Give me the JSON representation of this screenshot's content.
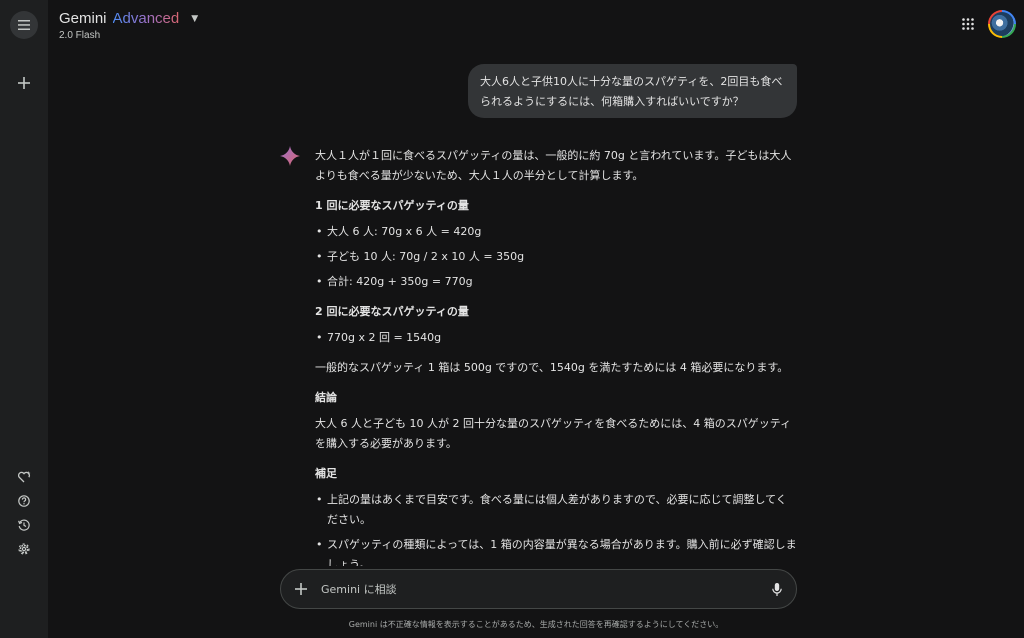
{
  "header": {
    "title_main": "Gemini",
    "title_advanced": "Advanced",
    "model_label": "2.0 Flash"
  },
  "sidebar": {
    "items": [
      {
        "name": "menu",
        "icon": "menu-icon"
      },
      {
        "name": "new-chat",
        "icon": "plus-icon"
      },
      {
        "name": "gems",
        "icon": "gem-heart-icon"
      },
      {
        "name": "help",
        "icon": "help-icon"
      },
      {
        "name": "activity",
        "icon": "history-icon"
      },
      {
        "name": "settings",
        "icon": "gear-icon"
      }
    ]
  },
  "conversation": {
    "user_message": "大人6人と子供10人に十分な量のスパゲティを、2回目も食べられるようにするには、何箱購入すればいいですか？",
    "response": {
      "intro": "大人１人が１回に食べるスパゲッティの量は、一般的に約 70g と言われています。子どもは大人よりも食べる量が少ないため、大人１人の半分として計算します。",
      "section1_heading": "1 回に必要なスパゲッティの量",
      "section1_items": [
        "大人 6 人: 70g x 6 人 = 420g",
        "子ども 10 人: 70g / 2 x 10 人 = 350g",
        "合計: 420g + 350g = 770g"
      ],
      "section2_heading": "2 回に必要なスパゲッティの量",
      "section2_items": [
        "770g x 2 回 = 1540g"
      ],
      "calc_text": "一般的なスパゲッティ 1 箱は 500g ですので、1540g を満たすためには 4 箱必要になります。",
      "conclusion_heading": "結論",
      "conclusion_text": "大人 6 人と子ども 10 人が 2 回十分な量のスパゲッティを食べるためには、4 箱のスパゲッティを購入する必要があります。",
      "notes_heading": "補足",
      "notes_items": [
        "上記の量はあくまで目安です。食べる量には個人差がありますので、必要に応じて調整してください。",
        "スパゲッティの種類によっては、1 箱の内容量が異なる場合があります。購入前に必ず確認しましょう。"
      ]
    }
  },
  "input": {
    "placeholder": "Gemini に相談"
  },
  "footer": {
    "disclaimer": "Gemini は不正確な情報を表示することがあるため、生成された回答を再確認するようにしてください。"
  },
  "colors": {
    "background": "#131314",
    "sidebar": "#1e1f20",
    "bubble": "#333537",
    "text": "#e3e3e3",
    "star_accent": "#d96570"
  }
}
